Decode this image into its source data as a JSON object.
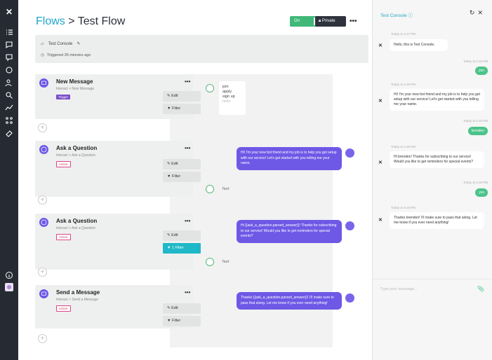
{
  "app": {
    "title_link": "Flows",
    "title_sep": ">",
    "title_current": "Test Flow",
    "toggle_label": "On",
    "private_label": "Private",
    "more": "•••"
  },
  "flow_header": {
    "console_tag": "Test Console",
    "triggered": "Triggered 35 minutes ago"
  },
  "steps": [
    {
      "title": "New Message",
      "subtitle": "Interact > New Message",
      "tag": "Trigger",
      "buttons": [
        "Edit",
        "Filter"
      ]
    },
    {
      "title": "Ask a Question",
      "subtitle": "Interact > Ask a Question",
      "tag": "Action",
      "buttons": [
        "Edit",
        "Filter"
      ]
    },
    {
      "title": "Ask a Question",
      "subtitle": "Interact > Ask a Question",
      "tag": "Action",
      "buttons": [
        "Edit",
        "1 Filter"
      ]
    },
    {
      "title": "Send a Message",
      "subtitle": "Interact > Send a Message",
      "tag": "Action",
      "buttons": [
        "Edit",
        "Filter"
      ]
    }
  ],
  "canvas": {
    "options": [
      "join",
      "apply",
      "sign up",
      "hello"
    ],
    "text_label": "Text",
    "bubbles": [
      "Hi! I'm your new bot friend and my job is to help you get setup with our service! Let's get started with you telling me your name.",
      "Hi {{ask_a_question.parsed_answer}}! Thanks for subscribing to our service! Would you like to get reminders for special events?",
      "Thanks {{ask_a_question.parsed_answer}}! I'll make sure to pass that along. Let me know if you ever need anything!"
    ]
  },
  "console": {
    "title": "Test Console",
    "messages": [
      {
        "time": "Today at 4:17 PM",
        "from": "bot",
        "text": "Hello, this is Test Console."
      },
      {
        "time": "Today at 4:18 PM",
        "from": "user",
        "text": "join"
      },
      {
        "time": "Today at 4:18 PM",
        "from": "bot",
        "text": "Hi! I'm your new bot friend and my job is to help you get setup with our service! Let's get started with you telling me your name."
      },
      {
        "time": "Today at 4:18 PM",
        "from": "user",
        "text": "brenden"
      },
      {
        "time": "Today at 4:18 PM",
        "from": "bot",
        "text": "Hi brenden! Thanks for subscribing to our service! Would you like to get reminders for special events?"
      },
      {
        "time": "Today at 4:18 PM",
        "from": "user",
        "text": "yes"
      },
      {
        "time": "Today at 4:18 PM",
        "from": "bot",
        "text": "Thanks brenden! I'll make sure to pass that along. Let me know if you ever need anything!"
      }
    ],
    "input_placeholder": "Type your message..."
  },
  "colors": {
    "sidebar": "#262a33",
    "accent": "#1fa6c9",
    "bot_bubble": "#6e58e6",
    "user_bubble": "#4cc38a",
    "toggle_on": "#3fb878"
  }
}
